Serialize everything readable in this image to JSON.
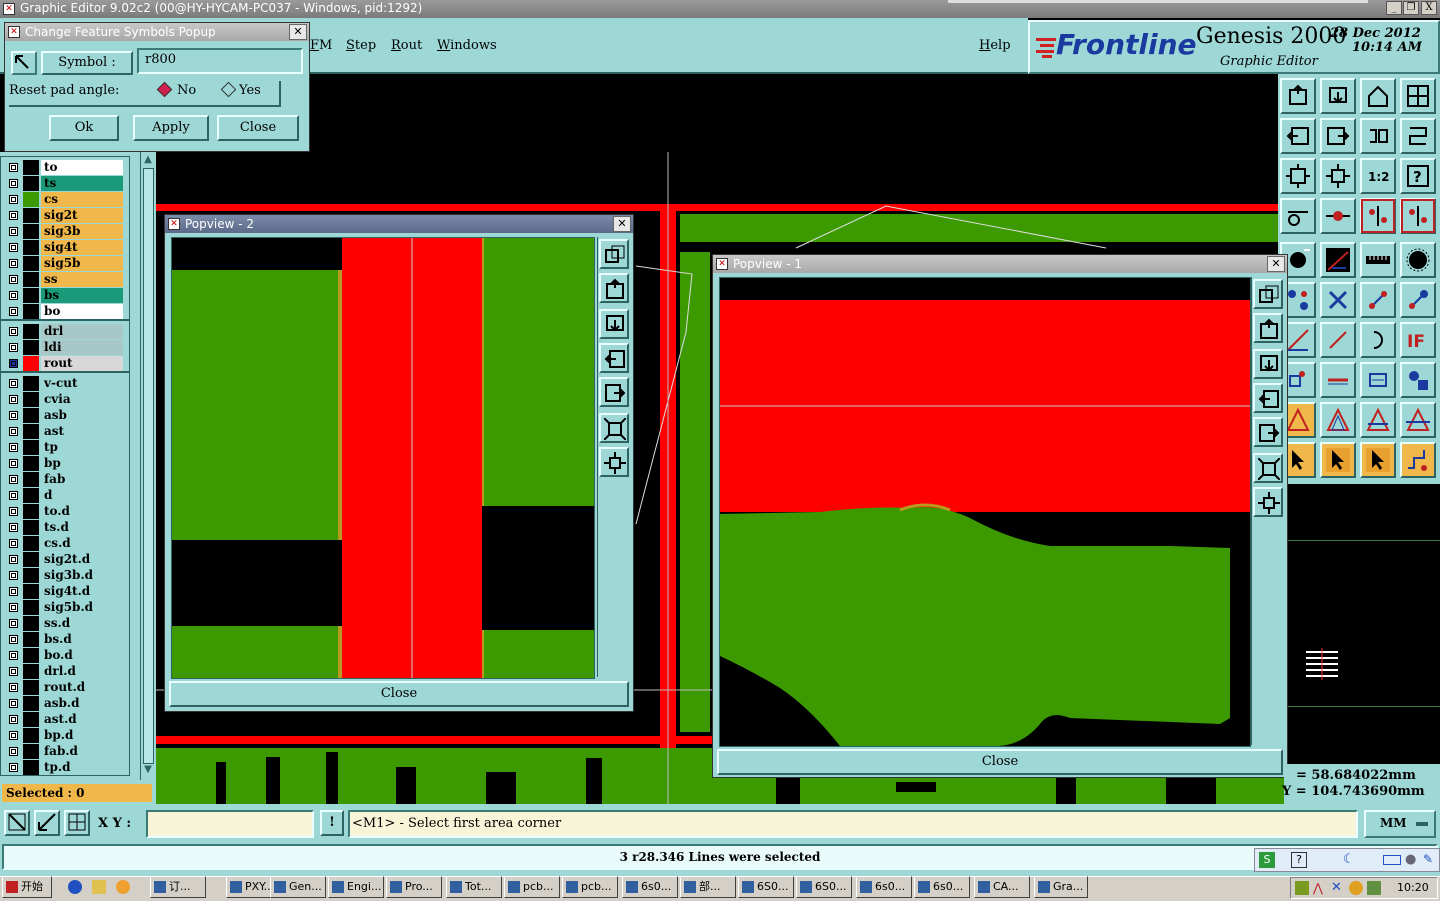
{
  "window": {
    "title": "Graphic Editor 9.02c2 (00@HY-HYCAM-PC037 - Windows, pid:1292)",
    "controls": [
      "_",
      "❐",
      "X"
    ]
  },
  "menu": {
    "items": [
      "FM",
      "Step",
      "Rout",
      "Windows"
    ],
    "help": "Help"
  },
  "brand": {
    "logo": "Frontline",
    "product": "Genesis 2000",
    "subtitle": "Graphic Editor",
    "date": "28 Dec 2012",
    "time": "10:14 AM"
  },
  "popup": {
    "title": "Change Feature Symbols Popup",
    "symbol_label": "Symbol :",
    "symbol_value": "r800",
    "reset_label": "Reset pad angle:",
    "option_no": "No",
    "option_yes": "Yes",
    "ok": "Ok",
    "apply": "Apply",
    "close": "Close"
  },
  "layers_board": [
    {
      "name": "to",
      "color": "#ffffff"
    },
    {
      "name": "ts",
      "color": "#1a9a78"
    },
    {
      "name": "cs",
      "color": "#f0b84a"
    },
    {
      "name": "sig2t",
      "color": "#f0b84a"
    },
    {
      "name": "sig3b",
      "color": "#f0b84a"
    },
    {
      "name": "sig4t",
      "color": "#f0b84a"
    },
    {
      "name": "sig5b",
      "color": "#f0b84a"
    },
    {
      "name": "ss",
      "color": "#f0b84a"
    },
    {
      "name": "bs",
      "color": "#1a9a78"
    },
    {
      "name": "bo",
      "color": "#ffffff"
    }
  ],
  "layers_drill": [
    {
      "name": "drl",
      "color": "#a8c8c8"
    },
    {
      "name": "ldi",
      "color": "#a8c8c8"
    },
    {
      "name": "rout",
      "color": "#d8d8d8"
    }
  ],
  "layers_misc": [
    {
      "name": "v-cut"
    },
    {
      "name": "cvia"
    },
    {
      "name": "asb"
    },
    {
      "name": "ast"
    },
    {
      "name": "tp"
    },
    {
      "name": "bp"
    },
    {
      "name": "fab"
    },
    {
      "name": "d"
    },
    {
      "name": "to.d"
    },
    {
      "name": "ts.d"
    },
    {
      "name": "cs.d"
    },
    {
      "name": "sig2t.d"
    },
    {
      "name": "sig3b.d"
    },
    {
      "name": "sig4t.d"
    },
    {
      "name": "sig5b.d"
    },
    {
      "name": "ss.d"
    },
    {
      "name": "bs.d"
    },
    {
      "name": "bo.d"
    },
    {
      "name": "drl.d"
    },
    {
      "name": "rout.d"
    },
    {
      "name": "asb.d"
    },
    {
      "name": "ast.d"
    },
    {
      "name": "bp.d"
    },
    {
      "name": "fab.d"
    },
    {
      "name": "tp.d"
    }
  ],
  "selected": "Selected : 0",
  "popview2": {
    "title": "Popview - 2",
    "close": "Close"
  },
  "popview1": {
    "title": "Popview - 1",
    "close": "Close"
  },
  "coords": {
    "x": "= 58.684022mm",
    "y": "Y = 104.743690mm"
  },
  "status": {
    "xy_label": "X Y :",
    "xy_value": "",
    "prompt": "<M1> - Select first area corner",
    "message": "3 r28.346 Lines were selected",
    "units": "MM"
  },
  "taskbar": {
    "start": "开始",
    "tasks": [
      "订...",
      "PXY...",
      "Gen...",
      "Engi...",
      "Pro...",
      "Tot...",
      "pcb...",
      "pcb...",
      "6s0...",
      "部...",
      "6S0...",
      "6S0...",
      "6s0...",
      "6s0...",
      "CA...",
      "Gra..."
    ],
    "clock": "10:20"
  },
  "colors": {
    "teal": "#9dd8d6",
    "copper": "#3c9a00",
    "rout": "#ff0000",
    "highlight": "#f0b84a"
  }
}
